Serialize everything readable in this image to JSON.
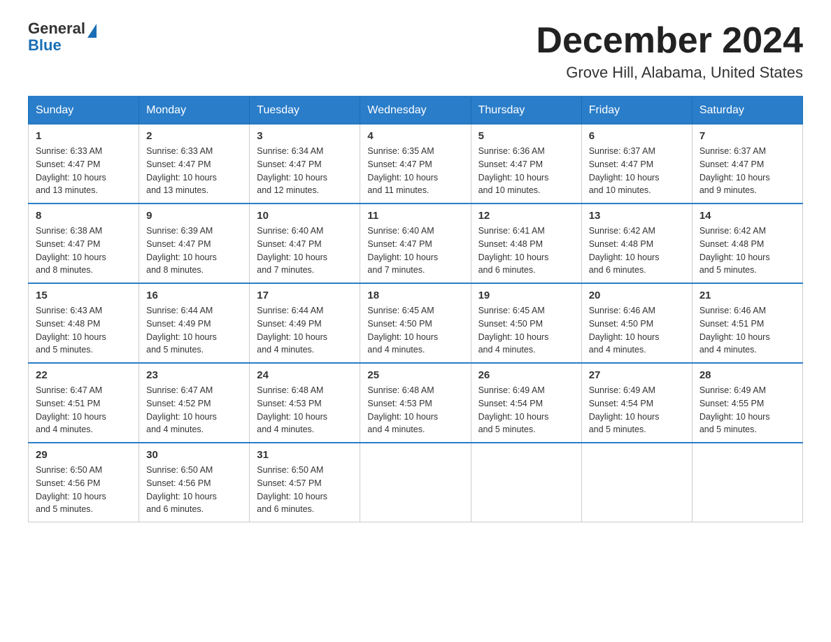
{
  "header": {
    "logo_general": "General",
    "logo_blue": "Blue",
    "month": "December 2024",
    "location": "Grove Hill, Alabama, United States"
  },
  "days_of_week": [
    "Sunday",
    "Monday",
    "Tuesday",
    "Wednesday",
    "Thursday",
    "Friday",
    "Saturday"
  ],
  "weeks": [
    [
      {
        "day": "1",
        "sunrise": "6:33 AM",
        "sunset": "4:47 PM",
        "daylight": "10 hours and 13 minutes."
      },
      {
        "day": "2",
        "sunrise": "6:33 AM",
        "sunset": "4:47 PM",
        "daylight": "10 hours and 13 minutes."
      },
      {
        "day": "3",
        "sunrise": "6:34 AM",
        "sunset": "4:47 PM",
        "daylight": "10 hours and 12 minutes."
      },
      {
        "day": "4",
        "sunrise": "6:35 AM",
        "sunset": "4:47 PM",
        "daylight": "10 hours and 11 minutes."
      },
      {
        "day": "5",
        "sunrise": "6:36 AM",
        "sunset": "4:47 PM",
        "daylight": "10 hours and 10 minutes."
      },
      {
        "day": "6",
        "sunrise": "6:37 AM",
        "sunset": "4:47 PM",
        "daylight": "10 hours and 10 minutes."
      },
      {
        "day": "7",
        "sunrise": "6:37 AM",
        "sunset": "4:47 PM",
        "daylight": "10 hours and 9 minutes."
      }
    ],
    [
      {
        "day": "8",
        "sunrise": "6:38 AM",
        "sunset": "4:47 PM",
        "daylight": "10 hours and 8 minutes."
      },
      {
        "day": "9",
        "sunrise": "6:39 AM",
        "sunset": "4:47 PM",
        "daylight": "10 hours and 8 minutes."
      },
      {
        "day": "10",
        "sunrise": "6:40 AM",
        "sunset": "4:47 PM",
        "daylight": "10 hours and 7 minutes."
      },
      {
        "day": "11",
        "sunrise": "6:40 AM",
        "sunset": "4:47 PM",
        "daylight": "10 hours and 7 minutes."
      },
      {
        "day": "12",
        "sunrise": "6:41 AM",
        "sunset": "4:48 PM",
        "daylight": "10 hours and 6 minutes."
      },
      {
        "day": "13",
        "sunrise": "6:42 AM",
        "sunset": "4:48 PM",
        "daylight": "10 hours and 6 minutes."
      },
      {
        "day": "14",
        "sunrise": "6:42 AM",
        "sunset": "4:48 PM",
        "daylight": "10 hours and 5 minutes."
      }
    ],
    [
      {
        "day": "15",
        "sunrise": "6:43 AM",
        "sunset": "4:48 PM",
        "daylight": "10 hours and 5 minutes."
      },
      {
        "day": "16",
        "sunrise": "6:44 AM",
        "sunset": "4:49 PM",
        "daylight": "10 hours and 5 minutes."
      },
      {
        "day": "17",
        "sunrise": "6:44 AM",
        "sunset": "4:49 PM",
        "daylight": "10 hours and 4 minutes."
      },
      {
        "day": "18",
        "sunrise": "6:45 AM",
        "sunset": "4:50 PM",
        "daylight": "10 hours and 4 minutes."
      },
      {
        "day": "19",
        "sunrise": "6:45 AM",
        "sunset": "4:50 PM",
        "daylight": "10 hours and 4 minutes."
      },
      {
        "day": "20",
        "sunrise": "6:46 AM",
        "sunset": "4:50 PM",
        "daylight": "10 hours and 4 minutes."
      },
      {
        "day": "21",
        "sunrise": "6:46 AM",
        "sunset": "4:51 PM",
        "daylight": "10 hours and 4 minutes."
      }
    ],
    [
      {
        "day": "22",
        "sunrise": "6:47 AM",
        "sunset": "4:51 PM",
        "daylight": "10 hours and 4 minutes."
      },
      {
        "day": "23",
        "sunrise": "6:47 AM",
        "sunset": "4:52 PM",
        "daylight": "10 hours and 4 minutes."
      },
      {
        "day": "24",
        "sunrise": "6:48 AM",
        "sunset": "4:53 PM",
        "daylight": "10 hours and 4 minutes."
      },
      {
        "day": "25",
        "sunrise": "6:48 AM",
        "sunset": "4:53 PM",
        "daylight": "10 hours and 4 minutes."
      },
      {
        "day": "26",
        "sunrise": "6:49 AM",
        "sunset": "4:54 PM",
        "daylight": "10 hours and 5 minutes."
      },
      {
        "day": "27",
        "sunrise": "6:49 AM",
        "sunset": "4:54 PM",
        "daylight": "10 hours and 5 minutes."
      },
      {
        "day": "28",
        "sunrise": "6:49 AM",
        "sunset": "4:55 PM",
        "daylight": "10 hours and 5 minutes."
      }
    ],
    [
      {
        "day": "29",
        "sunrise": "6:50 AM",
        "sunset": "4:56 PM",
        "daylight": "10 hours and 5 minutes."
      },
      {
        "day": "30",
        "sunrise": "6:50 AM",
        "sunset": "4:56 PM",
        "daylight": "10 hours and 6 minutes."
      },
      {
        "day": "31",
        "sunrise": "6:50 AM",
        "sunset": "4:57 PM",
        "daylight": "10 hours and 6 minutes."
      },
      null,
      null,
      null,
      null
    ]
  ],
  "labels": {
    "sunrise": "Sunrise:",
    "sunset": "Sunset:",
    "daylight": "Daylight:"
  }
}
